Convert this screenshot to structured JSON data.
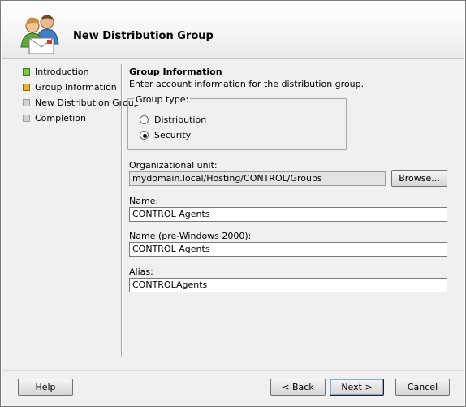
{
  "wizard": {
    "title": "New Distribution Group",
    "icon": "users-mail-icon"
  },
  "steps": [
    {
      "label": "Introduction",
      "state": "done"
    },
    {
      "label": "Group Information",
      "state": "current"
    },
    {
      "label": "New Distribution Group",
      "state": "pending"
    },
    {
      "label": "Completion",
      "state": "pending"
    }
  ],
  "form": {
    "section_title": "Group Information",
    "section_desc": "Enter account information for the distribution group.",
    "group_type": {
      "legend": "Group type:",
      "options": [
        {
          "label": "Distribution",
          "checked": false
        },
        {
          "label": "Security",
          "checked": true
        }
      ]
    },
    "org_unit": {
      "label": "Organizational unit:",
      "value": "mydomain.local/Hosting/CONTROL/Groups"
    },
    "browse_label": "Browse...",
    "name": {
      "label": "Name:",
      "value": "CONTROL Agents"
    },
    "name_pre2000": {
      "label": "Name (pre-Windows 2000):",
      "value": "CONTROL Agents"
    },
    "alias": {
      "label": "Alias:",
      "value": "CONTROLAgents"
    }
  },
  "buttons": {
    "help": "Help",
    "back": "< Back",
    "next": "Next >",
    "cancel": "Cancel"
  }
}
